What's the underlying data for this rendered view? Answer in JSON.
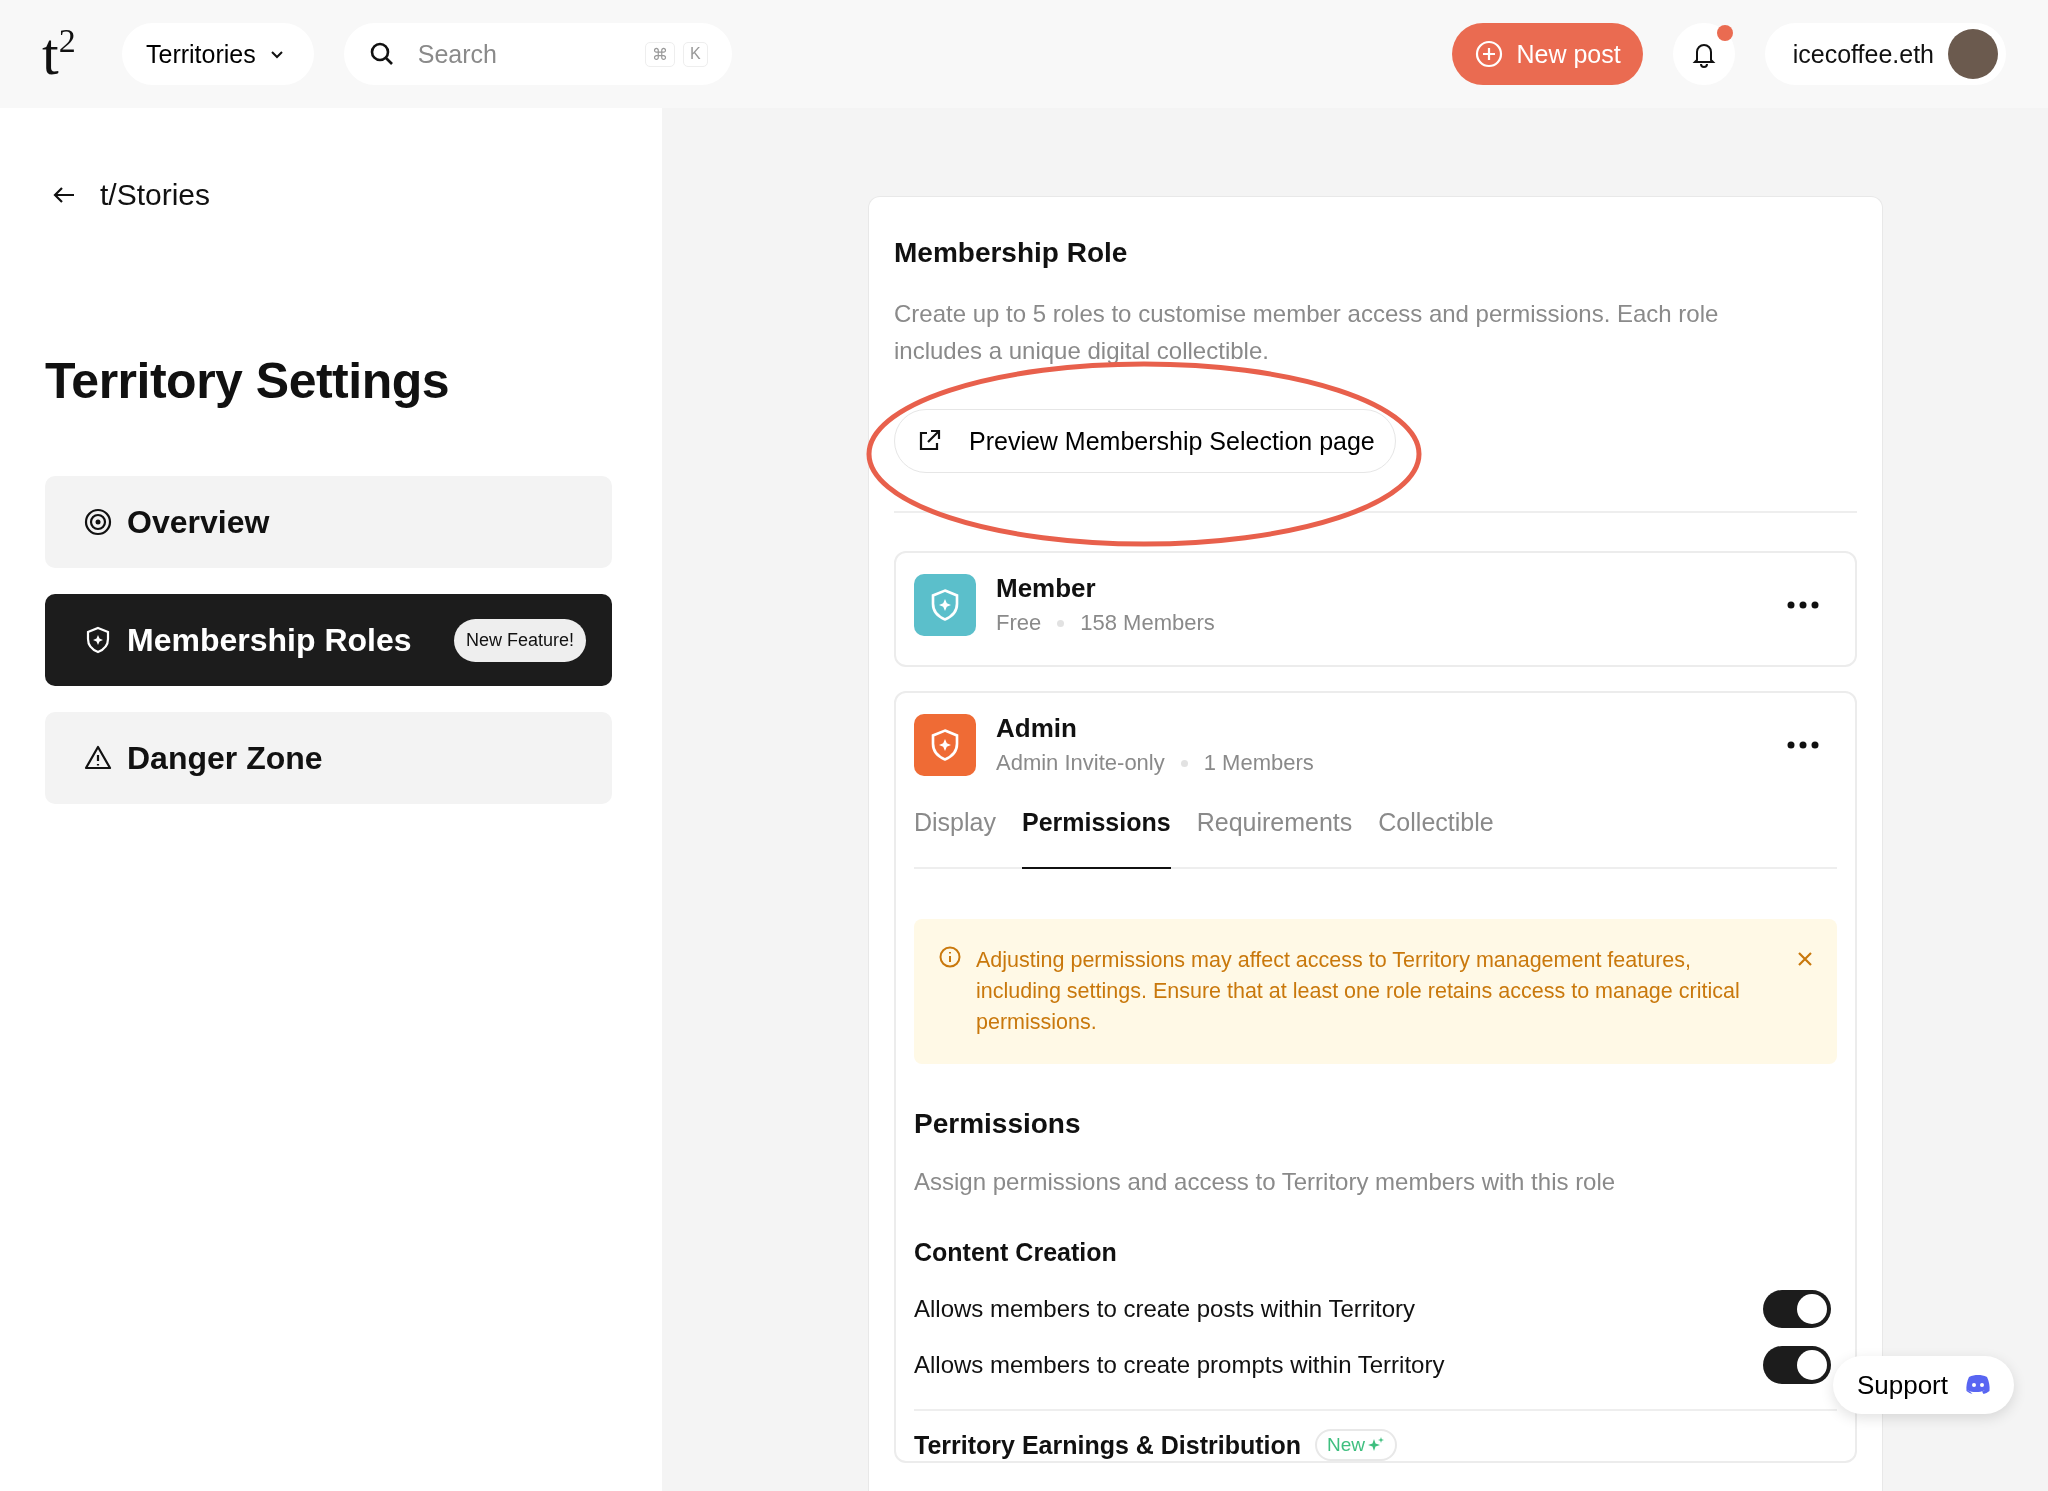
{
  "header": {
    "logo": "t",
    "logo_sup": "2",
    "territories": "Territories",
    "search": {
      "placeholder": "Search",
      "shortcut": [
        "⌘",
        "K"
      ]
    },
    "new_post": "New post",
    "notifications_unread": true,
    "username": "icecoffee.eth"
  },
  "sidebar": {
    "back": "t/Stories",
    "title": "Territory Settings",
    "items": [
      {
        "label": "Overview",
        "selected": false
      },
      {
        "label": "Membership Roles",
        "selected": true,
        "badge": "New Feature!"
      },
      {
        "label": "Danger Zone",
        "selected": false
      }
    ]
  },
  "card": {
    "title": "Membership Role",
    "description": "Create up to 5 roles to customise member access and permissions. Each role includes a unique digital collectible.",
    "preview_button": "Preview Membership Selection page",
    "roles": [
      {
        "name": "Member",
        "access": "Free",
        "count": "158 Members",
        "color": "#5bbfcb"
      },
      {
        "name": "Admin",
        "access": "Admin Invite-only",
        "count": "1 Members",
        "color": "#ef6b35"
      }
    ],
    "tabs": [
      {
        "label": "Display",
        "selected": false
      },
      {
        "label": "Permissions",
        "selected": true
      },
      {
        "label": "Requirements",
        "selected": false
      },
      {
        "label": "Collectible",
        "selected": false
      }
    ],
    "alert": "Adjusting permissions may affect access to Territory management features, including settings. Ensure that at least one role retains access to manage critical permissions.",
    "permissions_title": "Permissions",
    "permissions_description": "Assign permissions and access to Territory members with this role",
    "section": "Content Creation",
    "toggles": [
      {
        "label": "Allows members to create posts within Territory",
        "on": true
      },
      {
        "label": "Allows members to create prompts within Territory",
        "on": true
      }
    ],
    "earnings": "Territory Earnings & Distribution",
    "earnings_badge": "New"
  },
  "support": "Support"
}
